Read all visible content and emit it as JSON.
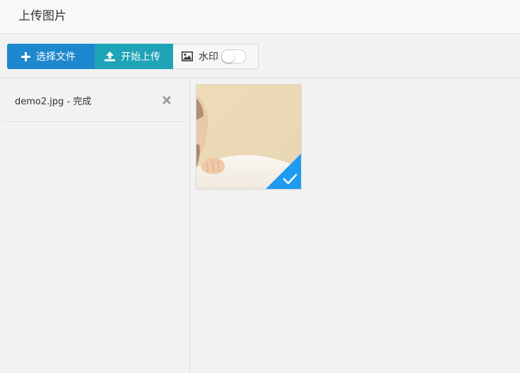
{
  "window": {
    "title": "上传图片"
  },
  "toolbar": {
    "select_label": "选择文件",
    "upload_label": "开始上传",
    "watermark_label": "水印",
    "watermark_enabled": false
  },
  "file_list": [
    {
      "name": "demo2.jpg - 完成"
    }
  ],
  "preview": {
    "items": [
      {
        "status": "done"
      }
    ]
  },
  "icons": {
    "select": "plus-icon",
    "upload": "upload-icon",
    "watermark": "image-icon",
    "remove": "close-icon",
    "done": "check-icon"
  },
  "colors": {
    "select_button": "#1e88cf",
    "upload_button": "#1fa3b6",
    "done_badge": "#1e9bf0"
  }
}
